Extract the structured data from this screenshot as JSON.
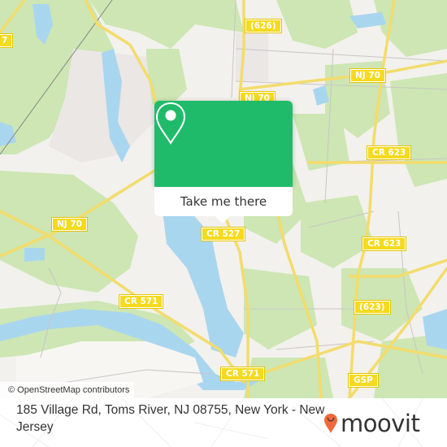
{
  "map": {
    "road_labels": [
      {
        "text": "(626)",
        "name": "shield-626"
      },
      {
        "text": "NJ 70",
        "name": "shield-nj70-top"
      },
      {
        "text": "NJ 70",
        "name": "shield-nj70-east"
      },
      {
        "text": "CR 623",
        "name": "shield-cr623-north"
      },
      {
        "text": "NJ 70",
        "name": "shield-nj70-west"
      },
      {
        "text": "CR 527",
        "name": "shield-cr527"
      },
      {
        "text": "CR 623",
        "name": "shield-cr623-south"
      },
      {
        "text": "CR 571",
        "name": "shield-cr571-west"
      },
      {
        "text": "(623)",
        "name": "shield-623"
      },
      {
        "text": "CR 571",
        "name": "shield-cr571-south"
      },
      {
        "text": "GSP",
        "name": "shield-gsp"
      },
      {
        "text": "7",
        "name": "shield-edge-left"
      }
    ],
    "attribution": "© OpenStreetMap contributors",
    "colors": {
      "land": "#f2f1ed",
      "park": "#cde6b3",
      "water": "#a9d6ef",
      "road": "#f3dc6c",
      "shield": "#f5da1e"
    }
  },
  "popup": {
    "button_label": "Take me there",
    "icon": "map-pin-icon",
    "color": "#20bb6a"
  },
  "footer": {
    "address": "185 Village Rd, Toms River, NJ 08755, New York - New Jersey",
    "brand": "moovit",
    "brand_color": "#f26a3c"
  }
}
